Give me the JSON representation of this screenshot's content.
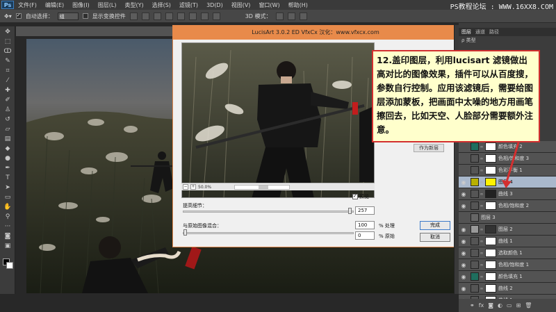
{
  "app": {
    "logo": "Ps",
    "menus": [
      "文件(F)",
      "编辑(E)",
      "图像(I)",
      "图层(L)",
      "类型(Y)",
      "选择(S)",
      "滤镜(T)",
      "3D(D)",
      "视图(V)",
      "窗口(W)",
      "帮助(H)"
    ],
    "watermark": "PS教程论坛 : WWW.16XX8.COM"
  },
  "options_bar": {
    "auto_select_label": "自动选择：",
    "auto_select_value": "组",
    "show_transform_label": "显示变换控件",
    "mode_3d_label": "3D 模式："
  },
  "dialog": {
    "title": "LucisArt 3.0.2 ED   VfxCx 汉化：www.vfxcx.com",
    "zoom": "50.0%",
    "preview_label": "预览",
    "detail_label": "提高细节：",
    "detail_value": "257",
    "blend_label": "与原始图像混合：",
    "process_value": "100",
    "process_unit": "% 处理",
    "original_value": "0",
    "original_unit": "% 原始",
    "ok_label": "完成",
    "cancel_label": "取消",
    "hidden_btn_1": "作为新层",
    "hidden_btn_2": "重设"
  },
  "annotation": {
    "text": "12.盖印图层，利用lucisart 滤镜做出高对比的图像效果，插件可以从百度搜，参数自行控制。应用该滤镜后，需要给图层添加蒙板，把画面中太噪的地方用画笔擦回去，比如天空、人脸部分需要额外注意。"
  },
  "panel": {
    "tabs": [
      "图层",
      "通道",
      "路径"
    ],
    "filter_label": "ρ 类型",
    "layers": [
      {
        "name": "颜色填充 2",
        "thumb": "#1f6e5e",
        "mask": "#ffffff",
        "eye": false,
        "selected": false
      },
      {
        "name": "色相/饱和度 3",
        "thumb": "#555555",
        "mask": "#ffffff",
        "eye": false,
        "selected": false
      },
      {
        "name": "色彩平衡 1",
        "thumb": "#555555",
        "mask": "#ffffff",
        "eye": false,
        "selected": false
      },
      {
        "name": "图层 4",
        "thumb": "#b8b000",
        "mask": "#fff200",
        "eye": true,
        "selected": true
      },
      {
        "name": "曲线 3",
        "thumb": "#555555",
        "mask": "#222222",
        "eye": true,
        "selected": false
      },
      {
        "name": "色相/饱和度 2",
        "thumb": "#555555",
        "mask": "#ffffff",
        "eye": true,
        "selected": false
      },
      {
        "name": "图层 3",
        "thumb": "#666666",
        "mask": "",
        "eye": false,
        "selected": false
      },
      {
        "name": "图层 2",
        "thumb": "#999999",
        "mask": "#333333",
        "eye": true,
        "selected": false
      },
      {
        "name": "曲线 1",
        "thumb": "#555555",
        "mask": "#ffffff",
        "eye": true,
        "selected": false
      },
      {
        "name": "选取颜色 1",
        "thumb": "#555555",
        "mask": "#ffffff",
        "eye": true,
        "selected": false
      },
      {
        "name": "色相/饱和度 1",
        "thumb": "#555555",
        "mask": "#ffffff",
        "eye": true,
        "selected": false
      },
      {
        "name": "颜色填充 1",
        "thumb": "#1f6e5e",
        "mask": "#ffffff",
        "eye": true,
        "selected": false
      },
      {
        "name": "曲线 2",
        "thumb": "#555555",
        "mask": "#ffffff",
        "eye": true,
        "selected": false
      },
      {
        "name": "曲线 1",
        "thumb": "#555555",
        "mask": "#ffffff",
        "eye": true,
        "selected": false
      }
    ]
  }
}
